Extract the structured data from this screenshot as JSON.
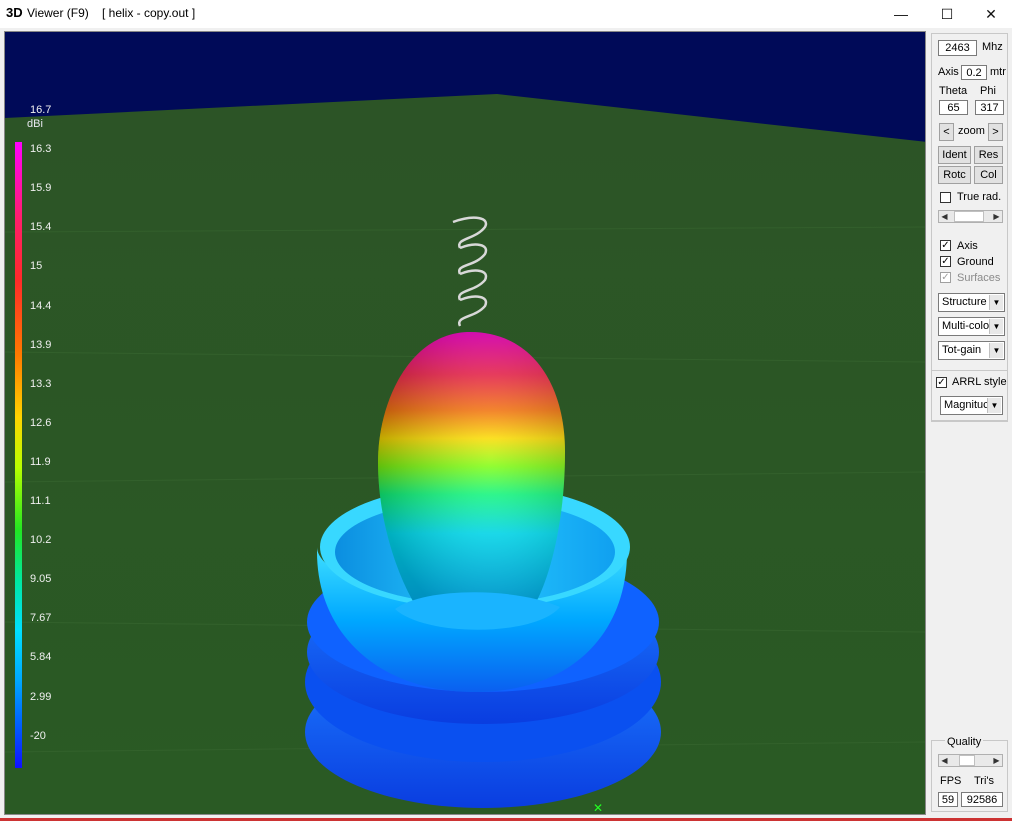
{
  "window": {
    "title_prefix": "3D",
    "title_main": "Viewer (F9)",
    "title_file": "[  helix - copy.out ]",
    "minimize_glyph": "—",
    "maximize_glyph": "☐",
    "close_glyph": "✕"
  },
  "colors": {
    "sky": "#000a58",
    "ground": "#2d5a25",
    "accent_line": "#cc3333"
  },
  "scale": {
    "unit": "dBi",
    "labels": [
      "16.7",
      "16.3",
      "15.9",
      "15.4",
      "15",
      "14.4",
      "13.9",
      "13.3",
      "12.6",
      "11.9",
      "11.1",
      "10.2",
      "9.05",
      "7.67",
      "5.84",
      "2.99",
      "-20"
    ]
  },
  "controls": {
    "frequency_value": "2463",
    "frequency_unit": "Mhz",
    "axis_label": "Axis",
    "axis_value": "0.2",
    "axis_unit": "mtr",
    "theta_label": "Theta",
    "phi_label": "Phi",
    "theta_value": "65",
    "phi_value": "317",
    "zoom_left": "<",
    "zoom_label": "zoom",
    "zoom_right": ">",
    "ident_label": "Ident",
    "res_label": "Res",
    "rotc_label": "Rotc",
    "col_label": "Col",
    "true_rad": {
      "label": "True rad.",
      "checked": false
    },
    "axis_toggle": {
      "label": "Axis",
      "checked": true
    },
    "ground_toggle": {
      "label": "Ground",
      "checked": true
    },
    "surfaces_toggle": {
      "label": "Surfaces",
      "checked": true,
      "disabled": true
    },
    "structure_select": "Structure",
    "color_select": "Multi-colo",
    "gain_select": "Tot-gain",
    "arrl_style": {
      "label": "ARRL style",
      "checked": true
    },
    "magnitude_select": "Magnituc"
  },
  "quality": {
    "label": "Quality",
    "fps_label": "FPS",
    "tris_label": "Tri's",
    "fps_value": "59",
    "tris_value": "92586"
  }
}
